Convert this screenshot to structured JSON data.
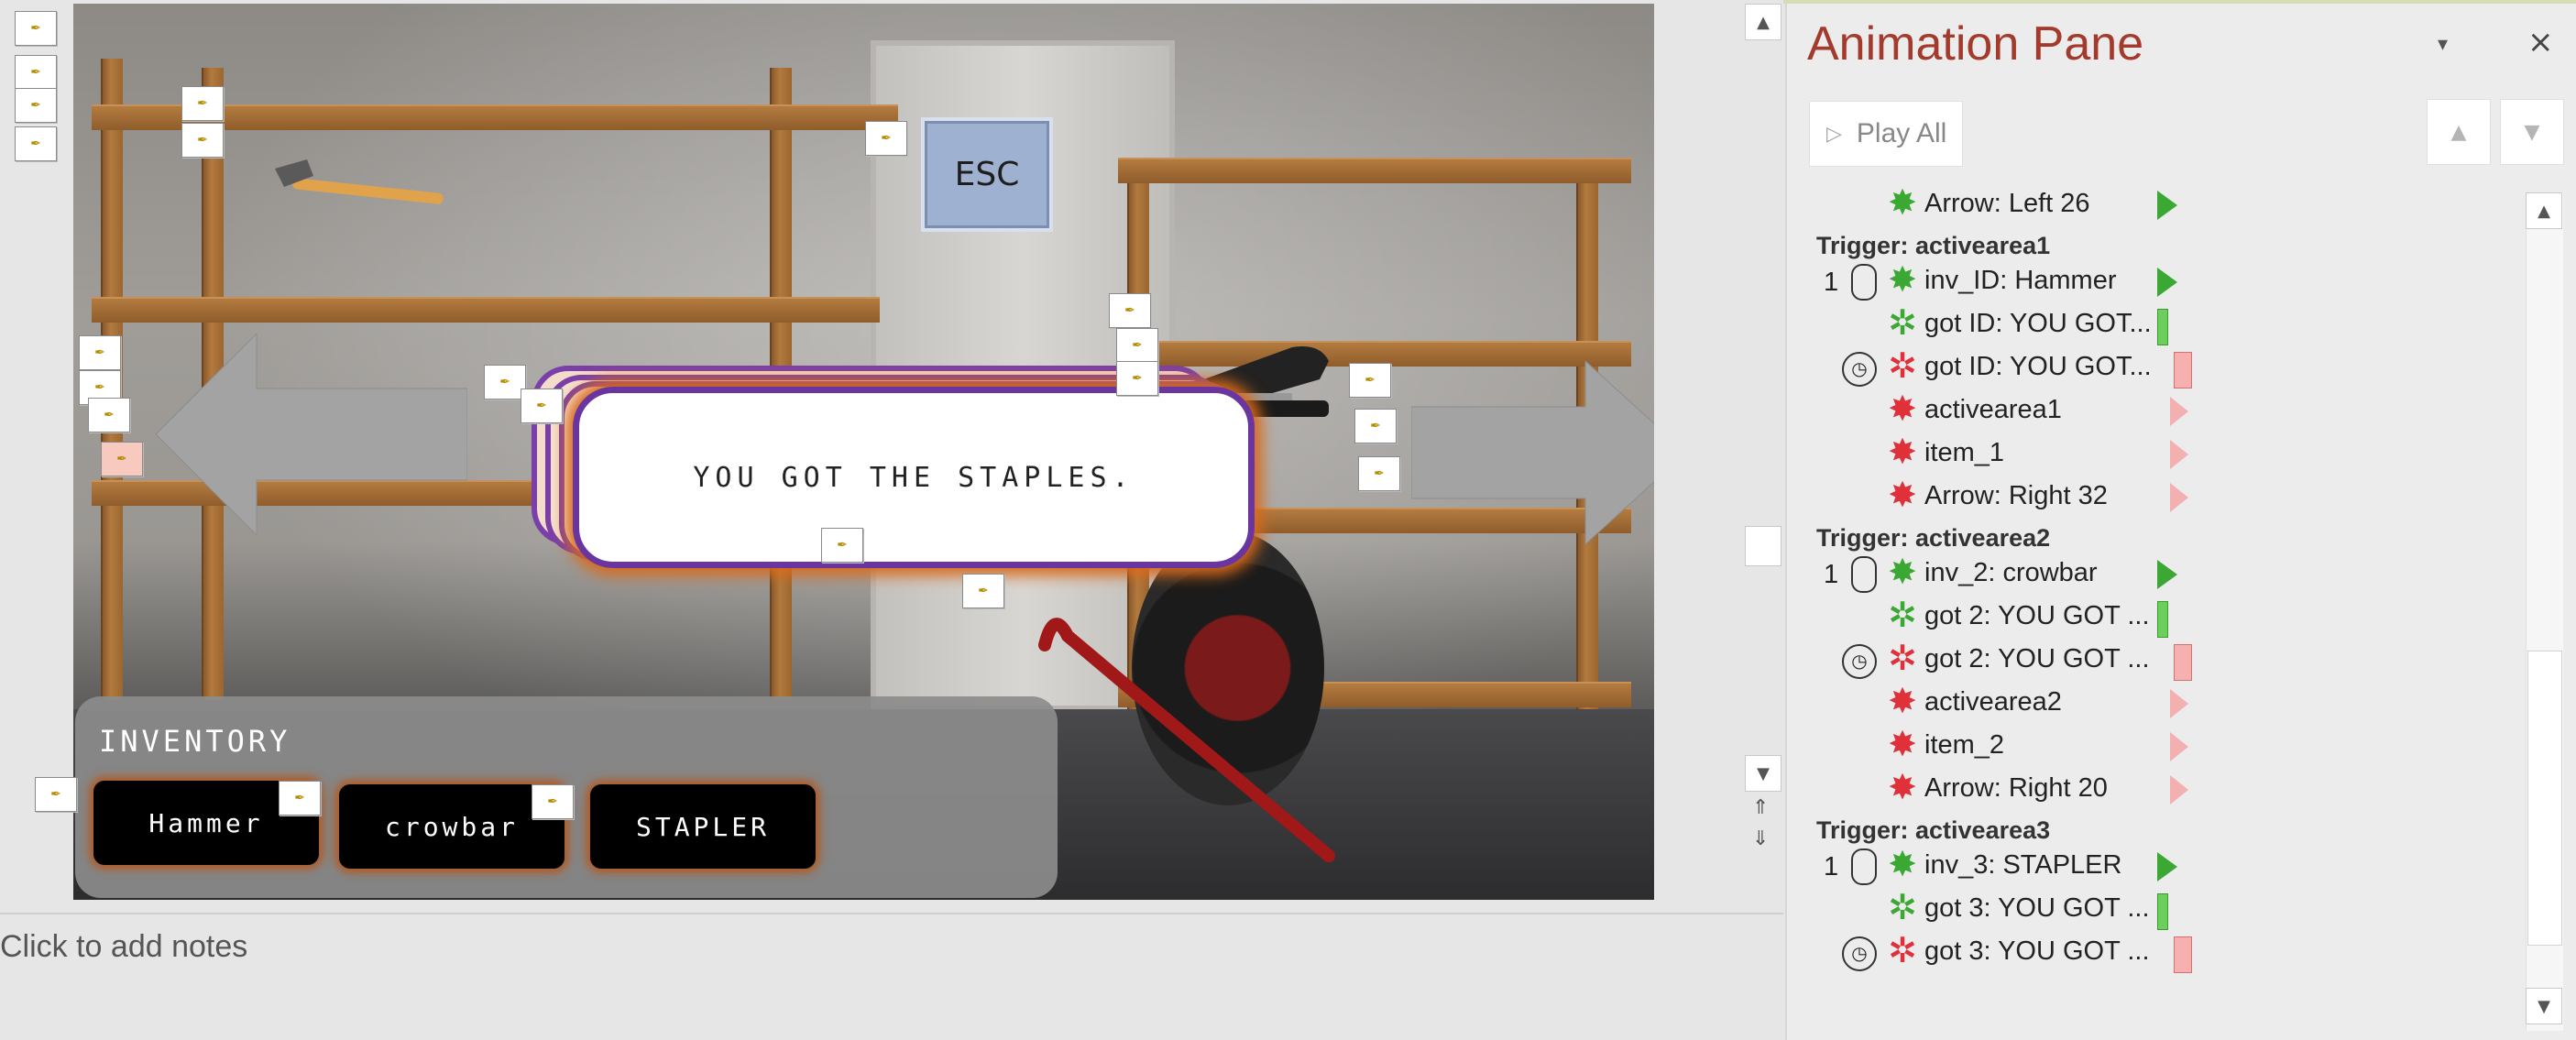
{
  "slide": {
    "esc_label": "ESC",
    "message": "YOU GOT THE STAPLES.",
    "inventory_title": "INVENTORY",
    "inventory_buttons": [
      "Hammer",
      "crowbar",
      "STAPLER"
    ],
    "thumb_glyph": "✒"
  },
  "notes": {
    "placeholder": "Click to add notes"
  },
  "pane": {
    "title": "Animation Pane",
    "play_all": "Play All",
    "close": "×",
    "menu": "▾",
    "up": "▲",
    "down": "▼",
    "rows": [
      {
        "label": "Arrow: Left 26",
        "type": "entrance"
      },
      {
        "trigger": "Trigger: activearea1"
      },
      {
        "num": "1",
        "start": "click",
        "label": "inv_ID: Hammer",
        "type": "entrance"
      },
      {
        "label": "got ID: YOU GOT...",
        "type": "motion"
      },
      {
        "start": "after",
        "label": "got ID: YOU GOT...",
        "type": "exit-motion"
      },
      {
        "label": "activearea1",
        "type": "exit"
      },
      {
        "label": "item_1",
        "type": "exit"
      },
      {
        "label": "Arrow: Right 32",
        "type": "exit"
      },
      {
        "trigger": "Trigger: activearea2"
      },
      {
        "num": "1",
        "start": "click",
        "label": "inv_2: crowbar",
        "type": "entrance"
      },
      {
        "label": "got 2: YOU GOT ...",
        "type": "motion"
      },
      {
        "start": "after",
        "label": "got 2: YOU GOT ...",
        "type": "exit-motion"
      },
      {
        "label": "activearea2",
        "type": "exit"
      },
      {
        "label": "item_2",
        "type": "exit"
      },
      {
        "label": "Arrow: Right 20",
        "type": "exit"
      },
      {
        "trigger": "Trigger: activearea3"
      },
      {
        "num": "1",
        "start": "click",
        "label": "inv_3: STAPLER",
        "type": "entrance"
      },
      {
        "label": "got 3: YOU GOT ...",
        "type": "motion"
      },
      {
        "start": "after",
        "label": "got 3: YOU GOT ...",
        "type": "exit-motion"
      }
    ]
  },
  "colors": {
    "entrance_green": "#3aa832",
    "exit_red": "#e0303a",
    "title_red": "#a33a2c",
    "message_border": "#6b35a0",
    "glow_orange": "#d96a1a"
  }
}
